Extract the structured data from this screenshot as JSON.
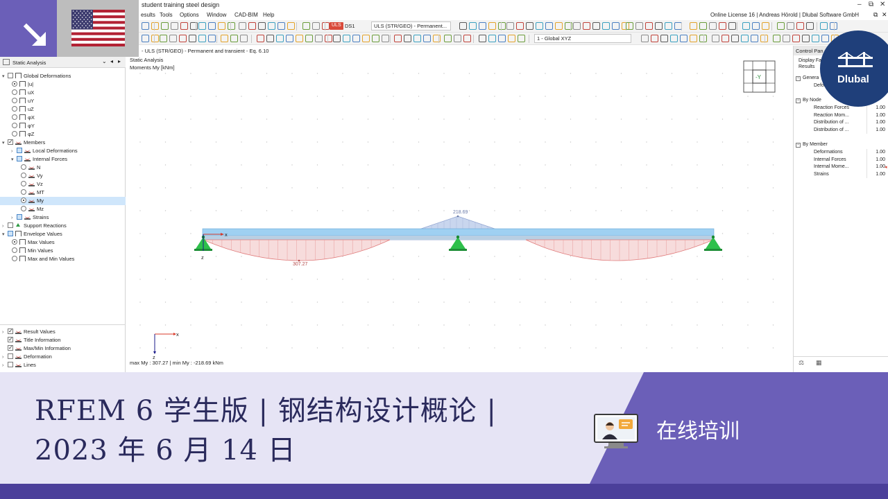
{
  "app": {
    "title": "student training steel design",
    "license": "Online License 16 | Andreas Hörold | Dlubal Software GmbH",
    "window_controls": [
      "–",
      "⧉",
      "✕"
    ]
  },
  "menu": [
    "esults",
    "Tools",
    "Options",
    "Window",
    "CAD-BIM",
    "Help"
  ],
  "toolbar": {
    "uls_badge": "ULS",
    "load_combo": "DS1",
    "design_situation": "ULS (STR/GEO) - Permanent...",
    "coordinate_system": "1 - Global XYZ"
  },
  "navigator": {
    "title": "Static Analysis",
    "items": [
      {
        "label": "Global Deformations",
        "kind": "check",
        "expander": "▾",
        "icon": "frame"
      },
      {
        "label": "|u|",
        "kind": "radio-on",
        "icon": "frame"
      },
      {
        "label": "uX",
        "kind": "radio",
        "icon": "frame"
      },
      {
        "label": "uY",
        "kind": "radio",
        "icon": "frame"
      },
      {
        "label": "uZ",
        "kind": "radio",
        "icon": "frame"
      },
      {
        "label": "φX",
        "kind": "radio",
        "icon": "frame"
      },
      {
        "label": "φY",
        "kind": "radio",
        "icon": "frame"
      },
      {
        "label": "φZ",
        "kind": "radio",
        "icon": "frame"
      },
      {
        "label": "Members",
        "kind": "check-on",
        "expander": "▾",
        "icon": "beam"
      },
      {
        "label": "Local Deformations",
        "kind": "check-part",
        "expander": "›",
        "icon": "beam"
      },
      {
        "label": "Internal Forces",
        "kind": "check-part",
        "expander": "▾",
        "icon": "beam"
      },
      {
        "label": "N",
        "kind": "radio",
        "icon": "beam"
      },
      {
        "label": "Vy",
        "kind": "radio",
        "icon": "beam"
      },
      {
        "label": "Vz",
        "kind": "radio",
        "icon": "beam"
      },
      {
        "label": "MT",
        "kind": "radio",
        "icon": "beam"
      },
      {
        "label": "My",
        "kind": "radio-on",
        "icon": "beam",
        "selected": true
      },
      {
        "label": "Mz",
        "kind": "radio",
        "icon": "beam"
      },
      {
        "label": "Strains",
        "kind": "check-part",
        "expander": "›",
        "icon": "beam"
      },
      {
        "label": "Support Reactions",
        "kind": "check",
        "expander": "›",
        "icon": "support"
      },
      {
        "label": "Envelope Values",
        "kind": "check-part",
        "expander": "▾",
        "icon": "frame"
      },
      {
        "label": "Max Values",
        "kind": "radio-on",
        "icon": "frame"
      },
      {
        "label": "Min Values",
        "kind": "radio",
        "icon": "frame"
      },
      {
        "label": "Max and Min Values",
        "kind": "radio",
        "icon": "frame"
      }
    ],
    "bottom_items": [
      {
        "label": "Result Values",
        "kind": "check-on",
        "expander": "›"
      },
      {
        "label": "Title Information",
        "kind": "check-on",
        "expander": ""
      },
      {
        "label": "Max/Min Information",
        "kind": "check-on",
        "expander": ""
      },
      {
        "label": "Deformation",
        "kind": "check",
        "expander": "›"
      },
      {
        "label": "Lines",
        "kind": "check",
        "expander": "›"
      }
    ]
  },
  "work": {
    "header_line1": "- ULS (STR/GEO) - Permanent and transient - Eq. 6.10",
    "header_line2": "Static Analysis",
    "header_line3": "Moments My [kNm]",
    "status": "max My : 307.27 | min My : -218.69 kNm",
    "value_max": "307.27",
    "value_min": "218.69",
    "axis_x": "x",
    "axis_z": "z",
    "view_cube_label": "-Y"
  },
  "control_panel": {
    "title": "Control Pan",
    "display_factors": "Display Fa",
    "results": "Results",
    "general_label": "Genera",
    "general_item": "Defor",
    "by_node": {
      "label": "By Node",
      "rows": [
        {
          "name": "Reaction Forces",
          "value": "1.00"
        },
        {
          "name": "Reaction Mom...",
          "value": "1.00"
        },
        {
          "name": "Distribution of ...",
          "value": "1.00"
        },
        {
          "name": "Distribution of ...",
          "value": "1.00"
        }
      ]
    },
    "by_member": {
      "label": "By Member",
      "rows": [
        {
          "name": "Deformations",
          "value": "1.00"
        },
        {
          "name": "Internal Forces",
          "value": "1.00"
        },
        {
          "name": "Internal Mome...",
          "value": "1.00"
        },
        {
          "name": "Strains",
          "value": "1.00"
        }
      ]
    }
  },
  "logo": {
    "text": "Dlubal"
  },
  "banner": {
    "line1": "RFEM 6 学生版 | 钢结构设计概论 |",
    "line2": "2023 年 6 月 14 日",
    "format_label": "在线培训"
  },
  "colors": {
    "purple_dark": "#4b3f9a",
    "purple_mid": "#6b5fb8",
    "banner_bg": "#e6e4f5",
    "logo_blue": "#1f3f7a",
    "beam_blue": "#9fd0f2",
    "positive_moment": "#e07a7a",
    "negative_moment": "#9aa7d6",
    "support_green": "#2ec04b"
  }
}
